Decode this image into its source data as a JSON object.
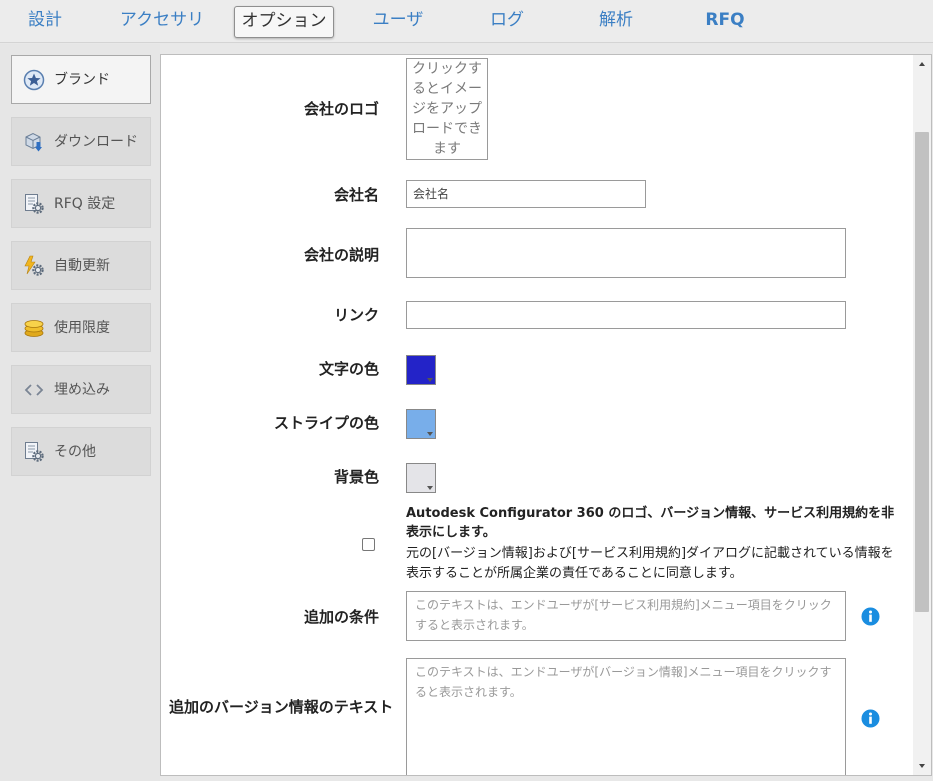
{
  "nav": {
    "tabs": [
      {
        "label": "設計"
      },
      {
        "label": "アクセサリ"
      },
      {
        "label": "オプション"
      },
      {
        "label": "ユーザ"
      },
      {
        "label": "ログ"
      },
      {
        "label": "解析"
      },
      {
        "label": "RFQ"
      }
    ],
    "active": "オプション"
  },
  "sidebar": {
    "items": [
      {
        "label": "ブランド",
        "icon": "star-badge-icon"
      },
      {
        "label": "ダウンロード",
        "icon": "download-cube-icon"
      },
      {
        "label": "RFQ 設定",
        "icon": "document-gear-icon"
      },
      {
        "label": "自動更新",
        "icon": "lightning-gear-icon"
      },
      {
        "label": "使用限度",
        "icon": "coins-icon"
      },
      {
        "label": "埋め込み",
        "icon": "code-brackets-icon"
      },
      {
        "label": "その他",
        "icon": "document-gear-icon"
      }
    ],
    "active": "ブランド"
  },
  "form": {
    "logo": {
      "label": "会社のロゴ",
      "hint": "クリックするとイメージをアップロードできます"
    },
    "company_name": {
      "label": "会社名",
      "value": "会社名"
    },
    "company_description": {
      "label": "会社の説明",
      "value": ""
    },
    "link": {
      "label": "リンク",
      "value": ""
    },
    "text_color": {
      "label": "文字の色",
      "color": "#2323c8"
    },
    "stripe_color": {
      "label": "ストライプの色",
      "color": "#78aeea"
    },
    "background_color": {
      "label": "背景色",
      "color": "#e4e4e8"
    },
    "hide_branding": {
      "checked": false,
      "title": "Autodesk Configurator 360 のロゴ、バージョン情報、サービス利用規約を非表示にします。",
      "note": "元の[バージョン情報]および[サービス利用規約]ダイアログに記載されている情報を表示することが所属企業の責任であることに同意します。"
    },
    "additional_terms": {
      "label": "追加の条件",
      "placeholder": "このテキストは、エンドユーザが[サービス利用規約]メニュー項目をクリックすると表示されます。"
    },
    "additional_version": {
      "label": "追加のバージョン情報のテキスト",
      "placeholder": "このテキストは、エンドユーザが[バージョン情報]メニュー項目をクリックすると表示されます。"
    }
  },
  "colors": {
    "accent": "#3b7fc4",
    "info": "#1a8de0"
  }
}
